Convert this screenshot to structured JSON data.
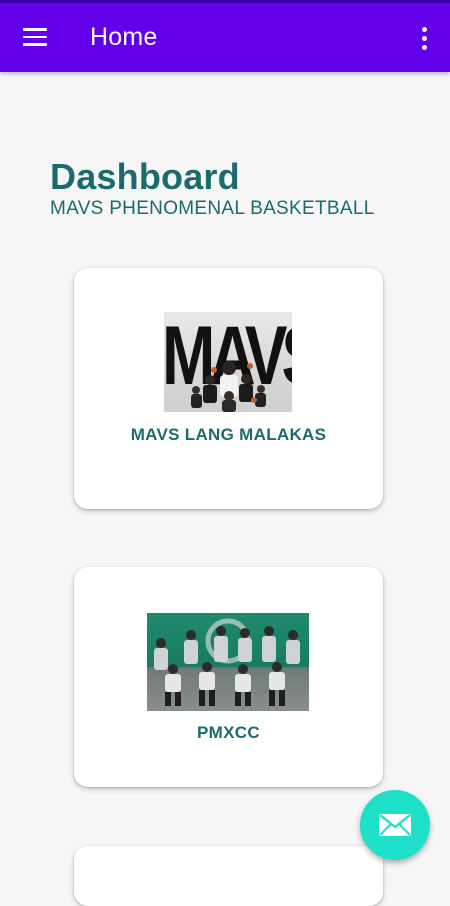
{
  "appbar": {
    "title": "Home",
    "menu_icon": "hamburger-menu-icon",
    "overflow_icon": "more-vertical-icon",
    "color": "#6200ea"
  },
  "dashboard": {
    "title": "Dashboard",
    "subtitle": "MAVS PHENOMENAL BASKETBALL",
    "accent_color": "#1b6b6e"
  },
  "cards": [
    {
      "label": "MAVS LANG MALAKAS",
      "image_text": "MAVS"
    },
    {
      "label": "PMXCC"
    },
    {
      "label": ""
    }
  ],
  "fab": {
    "icon": "mail-icon",
    "color": "#1ee0c8"
  }
}
